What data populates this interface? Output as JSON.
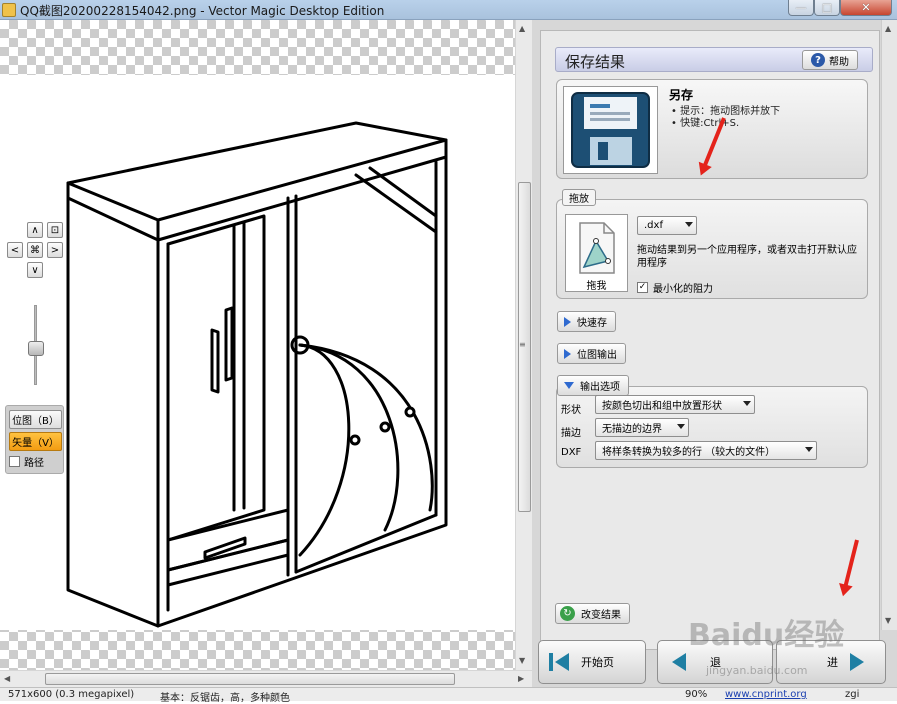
{
  "window": {
    "title": "QQ截图20200228154042.png - Vector Magic Desktop Edition",
    "minimize": "—",
    "maximize": "□",
    "close": "✕"
  },
  "view_controls": {
    "pan_up": "∧",
    "pan_down": "∨",
    "pan_left": "<",
    "pan_right": ">",
    "fit": "⌘",
    "zoom_fit": "⊡",
    "zoom_level": 0.45
  },
  "mode": {
    "bitmap": "位图（B）",
    "vector": "矢量（V）",
    "paths": "路径",
    "paths_checked": false
  },
  "panel": {
    "heading": "保存结果",
    "help": "帮助",
    "save_as": {
      "title": "另存",
      "hint": "• 提示：拖动图标并放下",
      "shortcut": "• 快键:Ctrl+S."
    },
    "drag": {
      "label": "拖放",
      "format": ".dxf",
      "drag_me": "拖我",
      "description": "拖动结果到另一个应用程序，或者双击打开默认应用程序",
      "minimize_resistance": "最小化的阻力",
      "minimize_checked": true
    },
    "quick_save": "快速存",
    "bitmap_output": "位图输出",
    "output_options": {
      "label": "输出选项",
      "rows": [
        {
          "label": "形状",
          "value": "按颜色切出和组中放置形状"
        },
        {
          "label": "描边",
          "value": "无描边的边界"
        },
        {
          "label": "DXF",
          "value": "将样条转换为较多的行 （较大的文件）"
        }
      ]
    },
    "change_result": "改变结果"
  },
  "nav_buttons": {
    "home": "开始页",
    "back": "退",
    "next": "进"
  },
  "status": {
    "size": "571x600 (0.3 megapixel)",
    "settings": "基本：反锯齿，高，多种颜色",
    "zoom": "90%",
    "link": "www.cnprint.org",
    "extra": "zgi"
  },
  "watermark": {
    "brand": "Baidu经验",
    "url": "jingyan.baidu.com"
  },
  "colors": {
    "accent_orange": "#f39c12",
    "help_blue": "#2b59a8",
    "arrow_red": "#e4231b"
  }
}
